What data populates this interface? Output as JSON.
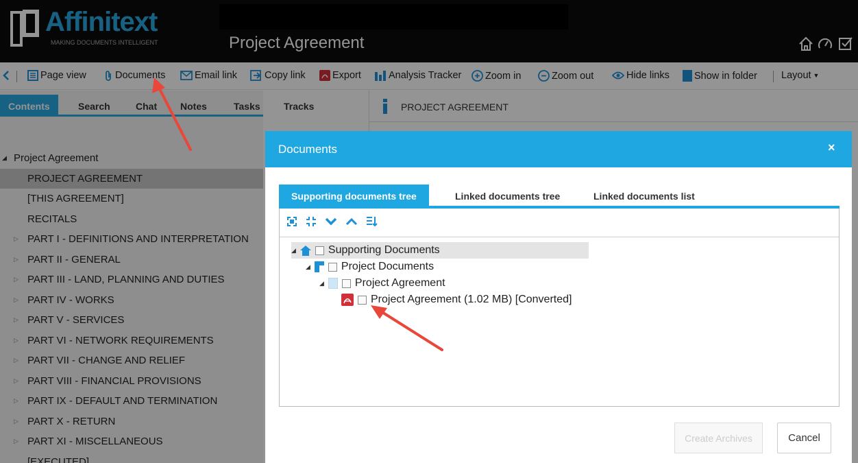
{
  "app": {
    "brand": "Affinitext",
    "tagline": "MAKING DOCUMENTS INTELLIGENT",
    "document_title": "Project Agreement"
  },
  "header_icons": [
    "home-icon",
    "dashboard-icon",
    "checklist-icon"
  ],
  "toolbar": {
    "page_view": "Page view",
    "documents": "Documents",
    "email_link": "Email link",
    "copy_link": "Copy link",
    "export": "Export",
    "analysis_tracker": "Analysis Tracker",
    "zoom_in": "Zoom in",
    "zoom_out": "Zoom out",
    "hide_links": "Hide links",
    "show_in_folder": "Show in folder",
    "layout": "Layout"
  },
  "left_panel": {
    "tabs": [
      "Contents",
      "Search",
      "Chat",
      "Notes",
      "Tasks",
      "Tracks"
    ],
    "active_tab": "Contents",
    "toc": [
      "Project Agreement",
      "PROJECT AGREEMENT",
      "[THIS AGREEMENT]",
      "RECITALS",
      "PART I - DEFINITIONS AND INTERPRETATION",
      "PART II - GENERAL",
      "PART III - LAND, PLANNING AND DUTIES",
      "PART IV - WORKS",
      "PART V - SERVICES",
      "PART VI - NETWORK REQUIREMENTS",
      "PART VII - CHANGE AND RELIEF",
      "PART VIII - FINANCIAL PROVISIONS",
      "PART IX - DEFAULT AND TERMINATION",
      "PART X - RETURN",
      "PART XI - MISCELLANEOUS",
      "[EXECUTED]"
    ]
  },
  "right_pane": {
    "section_title": "PROJECT AGREEMENT"
  },
  "modal": {
    "title": "Documents",
    "close": "×",
    "tabs": [
      "Supporting documents tree",
      "Linked documents tree",
      "Linked documents list"
    ],
    "active_tab": "Supporting documents tree",
    "tree": [
      {
        "label": "Supporting Documents",
        "checked": false
      },
      {
        "label": "Project Documents",
        "checked": false
      },
      {
        "label": "Project Agreement",
        "checked": false
      },
      {
        "label": "Project Agreement (1.02 MB) [Converted]",
        "checked": false
      }
    ],
    "buttons": {
      "create_archives": "Create Archives",
      "cancel": "Cancel"
    }
  },
  "colors": {
    "accent": "#1ea7e1",
    "pdf_red": "#d0303a",
    "topbar": "#0c0c0c",
    "arrow": "#e8473a"
  }
}
